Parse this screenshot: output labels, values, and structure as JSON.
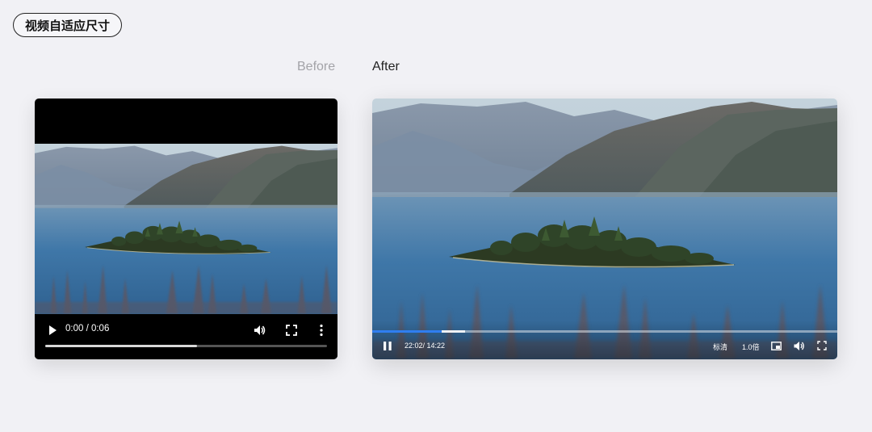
{
  "header": {
    "title": "视频自适应尺寸"
  },
  "labels": {
    "before": "Before",
    "after": "After"
  },
  "before_player": {
    "time": "0:00 / 0:06",
    "progress": 0.54,
    "icons": [
      "play-icon",
      "volume-icon",
      "fullscreen-icon",
      "more-vertical-icon"
    ]
  },
  "after_player": {
    "time": "22:02/ 14:22",
    "quality": "标清",
    "speed": "1.0倍",
    "progress": 0.15,
    "buffered": 0.2,
    "accent_color": "#2f7ef0",
    "icons": [
      "pause-icon",
      "picture-in-picture-icon",
      "volume-icon",
      "fullscreen-icon"
    ]
  }
}
